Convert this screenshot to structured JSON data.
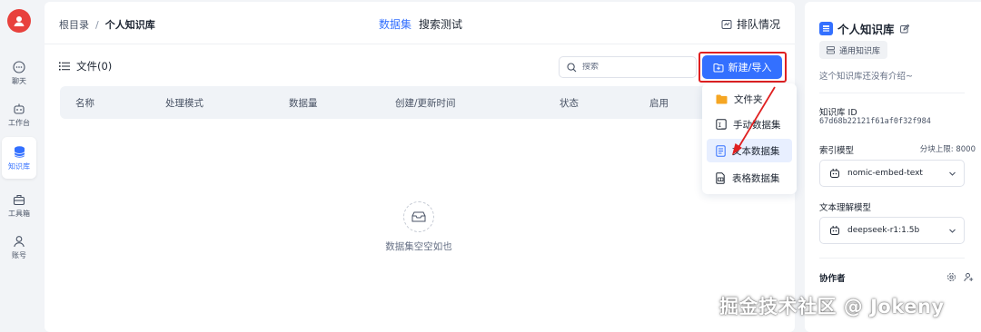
{
  "nav": {
    "items": [
      {
        "label": "聊天",
        "icon": "chat-icon"
      },
      {
        "label": "工作台",
        "icon": "robot-icon"
      },
      {
        "label": "知识库",
        "icon": "database-icon"
      },
      {
        "label": "工具箱",
        "icon": "toolbox-icon"
      },
      {
        "label": "账号",
        "icon": "user-icon"
      }
    ],
    "active_index": 2
  },
  "header": {
    "breadcrumb_root": "根目录",
    "breadcrumb_sep": "/",
    "breadcrumb_current": "个人知识库",
    "tabs": [
      "数据集",
      "搜索测试"
    ],
    "active_tab": 0,
    "queue_label": "排队情况"
  },
  "toolbar": {
    "files_label": "文件(0)",
    "search_placeholder": "搜索",
    "new_button_label": "新建/导入"
  },
  "table": {
    "columns": [
      "名称",
      "处理模式",
      "数据量",
      "创建/更新时间",
      "状态",
      "启用"
    ]
  },
  "empty": {
    "text": "数据集空空如也"
  },
  "dropdown": {
    "items": [
      {
        "label": "文件夹",
        "icon": "folder-icon"
      },
      {
        "label": "手动数据集",
        "icon": "manual-icon"
      },
      {
        "label": "文本数据集",
        "icon": "text-file-icon"
      },
      {
        "label": "表格数据集",
        "icon": "table-file-icon"
      }
    ],
    "highlighted_index": 2
  },
  "kb": {
    "title": "个人知识库",
    "type_badge": "通用知识库",
    "intro": "这个知识库还没有介绍~",
    "id_label": "知识库 ID",
    "id_value": "67d68b22121f61af0f32f984",
    "index_model_label": "索引模型",
    "chunk_limit": "分块上限: 8000",
    "index_model_value": "nomic-embed-text",
    "text_model_label": "文本理解模型",
    "text_model_value": "deepseek-r1:1.5b",
    "collaborators_label": "协作者"
  },
  "watermark": "掘金技术社区 @ Jokeny",
  "colors": {
    "accent": "#3370ff",
    "avatar": "#e8413d",
    "highlight_border": "#e02020"
  }
}
